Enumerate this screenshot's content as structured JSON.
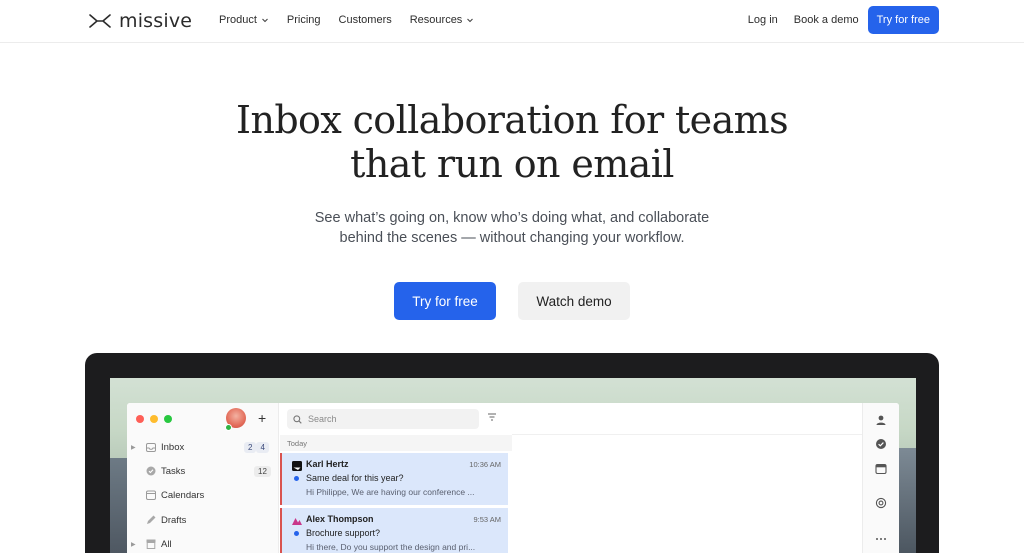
{
  "nav": {
    "brand": "missive",
    "links": [
      {
        "label": "Product",
        "dropdown": true
      },
      {
        "label": "Pricing",
        "dropdown": false
      },
      {
        "label": "Customers",
        "dropdown": false
      },
      {
        "label": "Resources",
        "dropdown": true
      }
    ],
    "login": "Log in",
    "demo": "Book a demo",
    "cta": "Try for free"
  },
  "hero": {
    "title_line1": "Inbox collaboration for teams",
    "title_line2": "that run on email",
    "subtitle_line1": "See what’s going on, know who’s doing what, and collaborate",
    "subtitle_line2": "behind the scenes — without changing your workflow.",
    "primary_cta": "Try for free",
    "secondary_cta": "Watch demo"
  },
  "app": {
    "plus": "+",
    "sidebar": [
      {
        "label": "Inbox",
        "icon": "inbox-icon",
        "badges": [
          "2",
          "4"
        ],
        "caret": true
      },
      {
        "label": "Tasks",
        "icon": "check-circle-icon",
        "badges": [
          "12"
        ],
        "caret": false
      },
      {
        "label": "Calendars",
        "icon": "calendar-icon",
        "badges": [],
        "caret": false
      },
      {
        "label": "Drafts",
        "icon": "pencil-icon",
        "badges": [],
        "caret": false
      },
      {
        "label": "All",
        "icon": "archive-icon",
        "badges": [],
        "caret": true
      }
    ],
    "search_placeholder": "Search",
    "list_header": "Today",
    "conversations": [
      {
        "name": "Karl Hertz",
        "time": "10:36 AM",
        "subject": "Same deal for this year?",
        "preview": "Hi Philippe, We are having our conference ..."
      },
      {
        "name": "Alex Thompson",
        "time": "9:53 AM",
        "subject": "Brochure support?",
        "preview": "Hi there, Do you support the design and pri..."
      }
    ]
  },
  "colors": {
    "accent": "#2563eb",
    "device": "#1c1c1e",
    "selected_row": "#dbe7fb",
    "unread_marker": "#d9534f"
  }
}
